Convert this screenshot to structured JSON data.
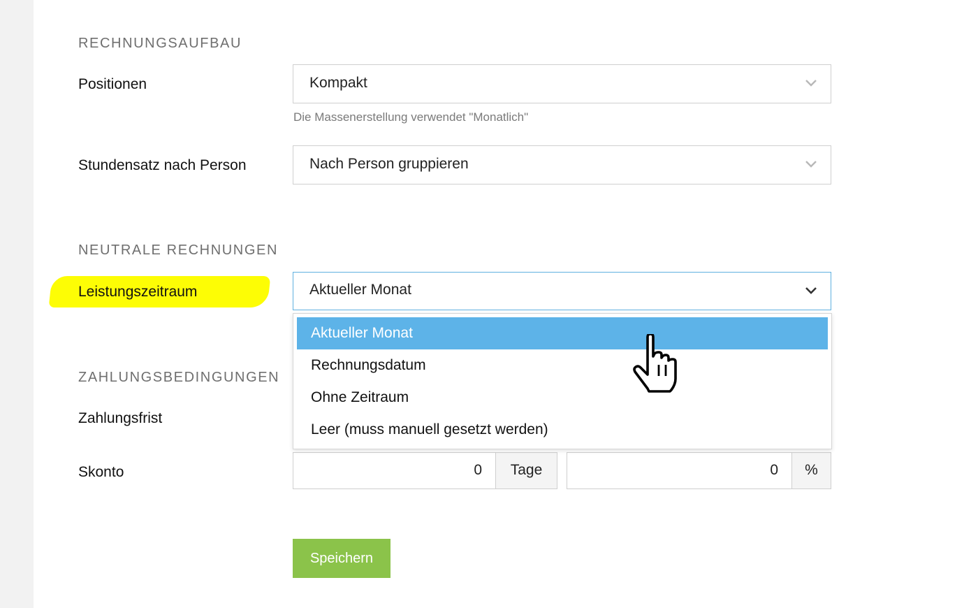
{
  "sections": {
    "invoice_structure": "RECHNUNGSAUFBAU",
    "neutral_invoices": "NEUTRALE RECHNUNGEN",
    "payment_terms": "ZAHLUNGSBEDINGUNGEN"
  },
  "fields": {
    "positions": {
      "label": "Positionen",
      "value": "Kompakt",
      "hint": "Die Massenerstellung verwendet \"Monatlich\""
    },
    "hourly_rate": {
      "label": "Stundensatz nach Person",
      "value": "Nach Person gruppieren"
    },
    "service_period": {
      "label": "Leistungszeitraum",
      "value": "Aktueller Monat",
      "options": [
        "Aktueller Monat",
        "Rechnungsdatum",
        "Ohne Zeitraum",
        "Leer (muss manuell gesetzt werden)"
      ]
    },
    "payment_deadline": {
      "label": "Zahlungsfrist"
    },
    "discount": {
      "label": "Skonto",
      "days_value": "0",
      "days_unit": "Tage",
      "percent_value": "0",
      "percent_unit": "%"
    }
  },
  "save_label": "Speichern",
  "colors": {
    "accent": "#5db3e8",
    "save": "#8bc34a",
    "highlight": "#fdfd05"
  },
  "icons": {
    "select_chevron": "chevron-down-icon",
    "cursor": "hand-pointer-icon"
  }
}
